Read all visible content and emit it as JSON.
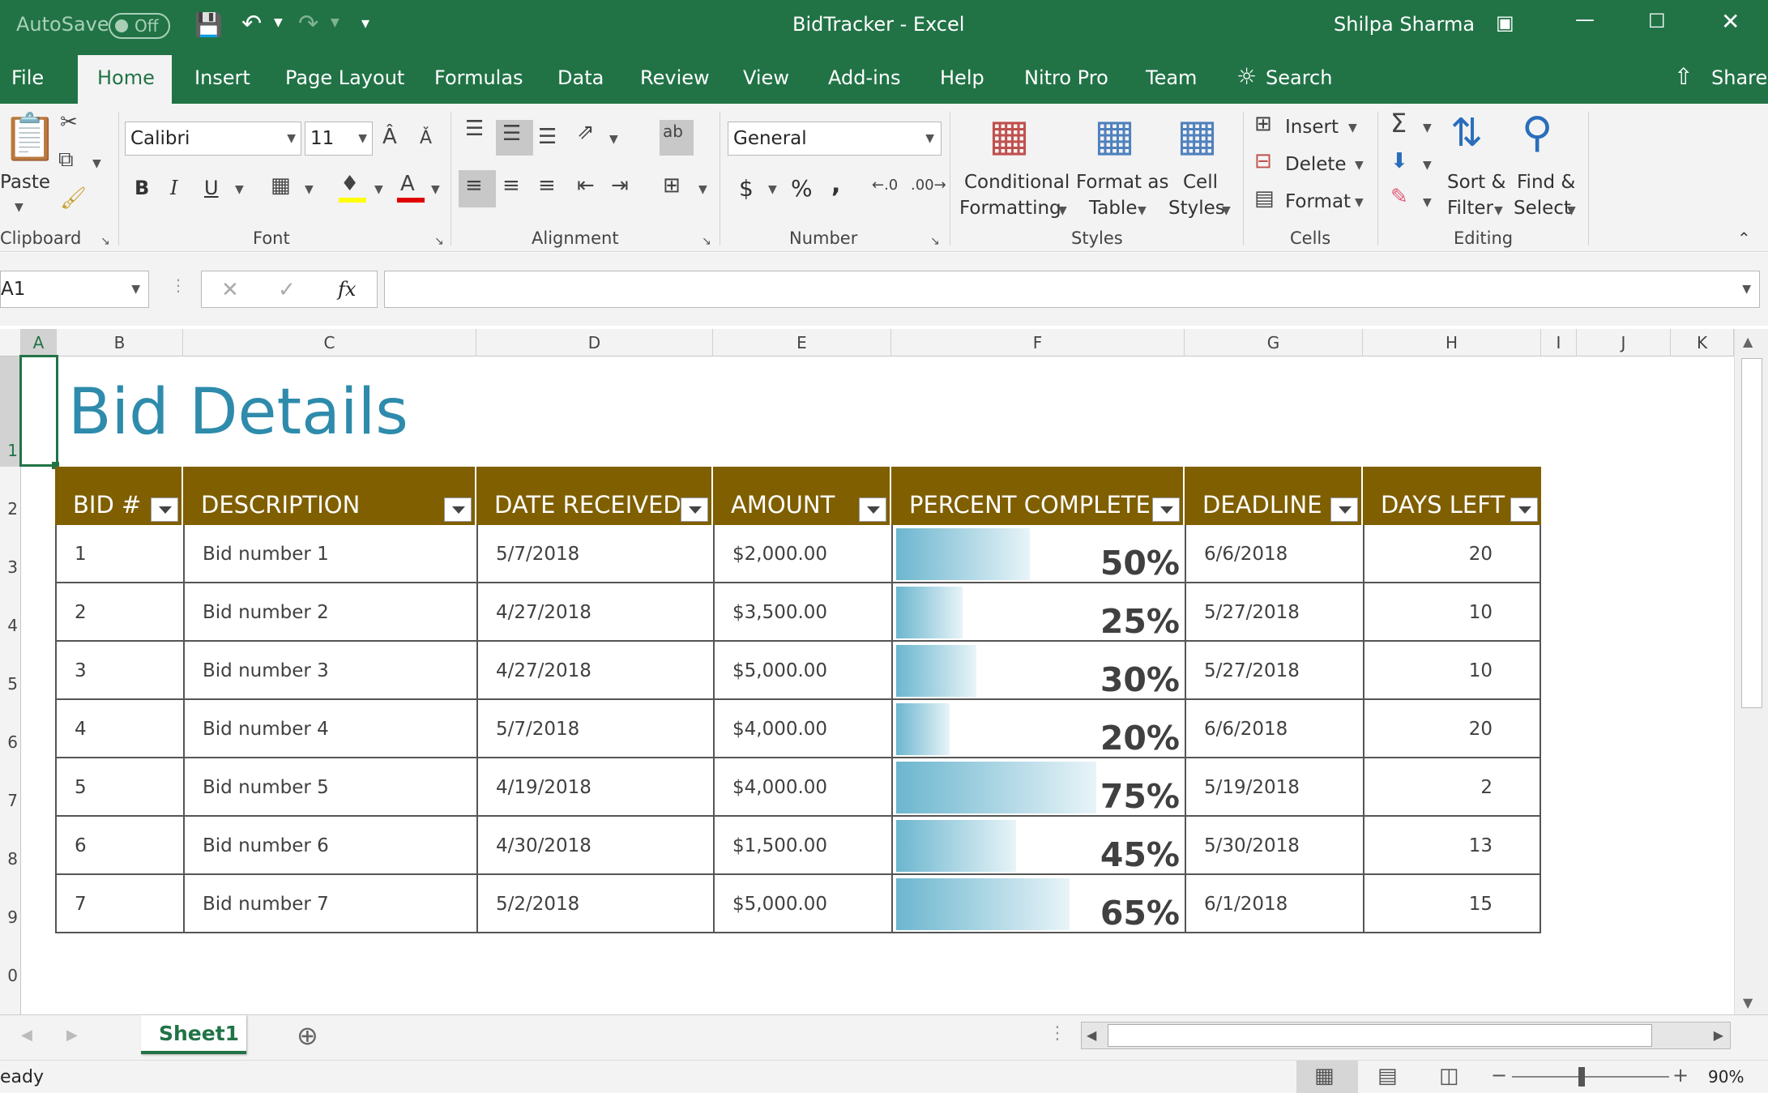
{
  "titlebar": {
    "autosave_label": "AutoSave",
    "autosave_state": "Off",
    "window_title": "BidTracker  -  Excel",
    "user_name": "Shilpa Sharma"
  },
  "tabs": [
    "File",
    "Home",
    "Insert",
    "Page Layout",
    "Formulas",
    "Data",
    "Review",
    "View",
    "Add-ins",
    "Help",
    "Nitro Pro",
    "Team"
  ],
  "search_label": "Search",
  "share_label": "Share",
  "ribbon": {
    "clipboard": {
      "paste": "Paste",
      "label": "Clipboard"
    },
    "font": {
      "name": "Calibri",
      "size": "11",
      "label": "Font",
      "bold": "B",
      "italic": "I",
      "underline": "U"
    },
    "alignment": {
      "label": "Alignment"
    },
    "number": {
      "format": "General",
      "label": "Number",
      "currency": "$",
      "percent": "%",
      "comma": ","
    },
    "styles": {
      "conditional_1": "Conditional",
      "conditional_2": "Formatting",
      "format_as_1": "Format as",
      "format_as_2": "Table",
      "cell_styles_1": "Cell",
      "cell_styles_2": "Styles",
      "label": "Styles"
    },
    "cells": {
      "insert": "Insert",
      "delete": "Delete",
      "format": "Format",
      "label": "Cells"
    },
    "editing": {
      "sort_1": "Sort &",
      "sort_2": "Filter",
      "find_1": "Find &",
      "find_2": "Select",
      "label": "Editing"
    }
  },
  "formula_bar": {
    "name_box": "A1",
    "fx": "fx",
    "value": ""
  },
  "columns": [
    "A",
    "B",
    "C",
    "D",
    "E",
    "F",
    "G",
    "H",
    "I",
    "J",
    "K"
  ],
  "rows": [
    "1",
    "2",
    "3",
    "4",
    "5",
    "6",
    "7",
    "8",
    "9",
    "0"
  ],
  "sheet_title": "Bid Details",
  "table": {
    "headers": [
      "BID #",
      "DESCRIPTION",
      "DATE RECEIVED",
      "AMOUNT",
      "PERCENT COMPLETE",
      "DEADLINE",
      "DAYS LEFT"
    ],
    "rows": [
      {
        "bid": "1",
        "desc": "Bid number 1",
        "date": "5/7/2018",
        "amount": "$2,000.00",
        "pct_label": "50%",
        "pct": 0.5,
        "deadline": "6/6/2018",
        "days": "20"
      },
      {
        "bid": "2",
        "desc": "Bid number 2",
        "date": "4/27/2018",
        "amount": "$3,500.00",
        "pct_label": "25%",
        "pct": 0.25,
        "deadline": "5/27/2018",
        "days": "10"
      },
      {
        "bid": "3",
        "desc": "Bid number 3",
        "date": "4/27/2018",
        "amount": "$5,000.00",
        "pct_label": "30%",
        "pct": 0.3,
        "deadline": "5/27/2018",
        "days": "10"
      },
      {
        "bid": "4",
        "desc": "Bid number 4",
        "date": "5/7/2018",
        "amount": "$4,000.00",
        "pct_label": "20%",
        "pct": 0.2,
        "deadline": "6/6/2018",
        "days": "20"
      },
      {
        "bid": "5",
        "desc": "Bid number 5",
        "date": "4/19/2018",
        "amount": "$4,000.00",
        "pct_label": "75%",
        "pct": 0.75,
        "deadline": "5/19/2018",
        "days": "2"
      },
      {
        "bid": "6",
        "desc": "Bid number 6",
        "date": "4/30/2018",
        "amount": "$1,500.00",
        "pct_label": "45%",
        "pct": 0.45,
        "deadline": "5/30/2018",
        "days": "13"
      },
      {
        "bid": "7",
        "desc": "Bid number 7",
        "date": "5/2/2018",
        "amount": "$5,000.00",
        "pct_label": "65%",
        "pct": 0.65,
        "deadline": "6/1/2018",
        "days": "15"
      }
    ]
  },
  "sheet_tab": "Sheet1",
  "status": {
    "ready": "eady",
    "zoom": "90%"
  },
  "colors": {
    "excel_green": "#217346",
    "header_brown": "#7f5f00",
    "title_teal": "#2e8bab",
    "bar": "#6cb6cf"
  }
}
